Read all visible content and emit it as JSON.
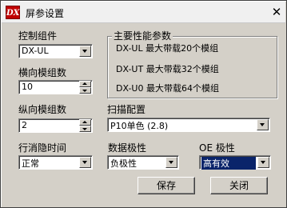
{
  "window": {
    "title": "屏参设置",
    "icon_text": "DX",
    "close_glyph": "✕"
  },
  "left": {
    "control_label": "控制组件",
    "control_value": "DX-UL",
    "horizontal_label": "横向模组数",
    "horizontal_value": "10",
    "vertical_label": "纵向模组数",
    "vertical_value": "2",
    "blanking_label": "行消隐时间",
    "blanking_value": "正常"
  },
  "params": {
    "title": "主要性能参数",
    "lines": [
      "DX-UL 最大带载20个模组",
      "DX-UT 最大带载32个模组",
      "DX-U0 最大带载64个模组"
    ]
  },
  "scan": {
    "label": "扫描配置",
    "value": "P10单色 (2.8)"
  },
  "polarity": {
    "data_label": "数据极性",
    "data_value": "负极性",
    "oe_label": "OE 极性",
    "oe_value": "高有效"
  },
  "buttons": {
    "save": "保存",
    "close": "关闭"
  },
  "colors": {
    "face": "#d4d0c8",
    "selection": "#0a246a",
    "icon_red": "#c00000"
  }
}
